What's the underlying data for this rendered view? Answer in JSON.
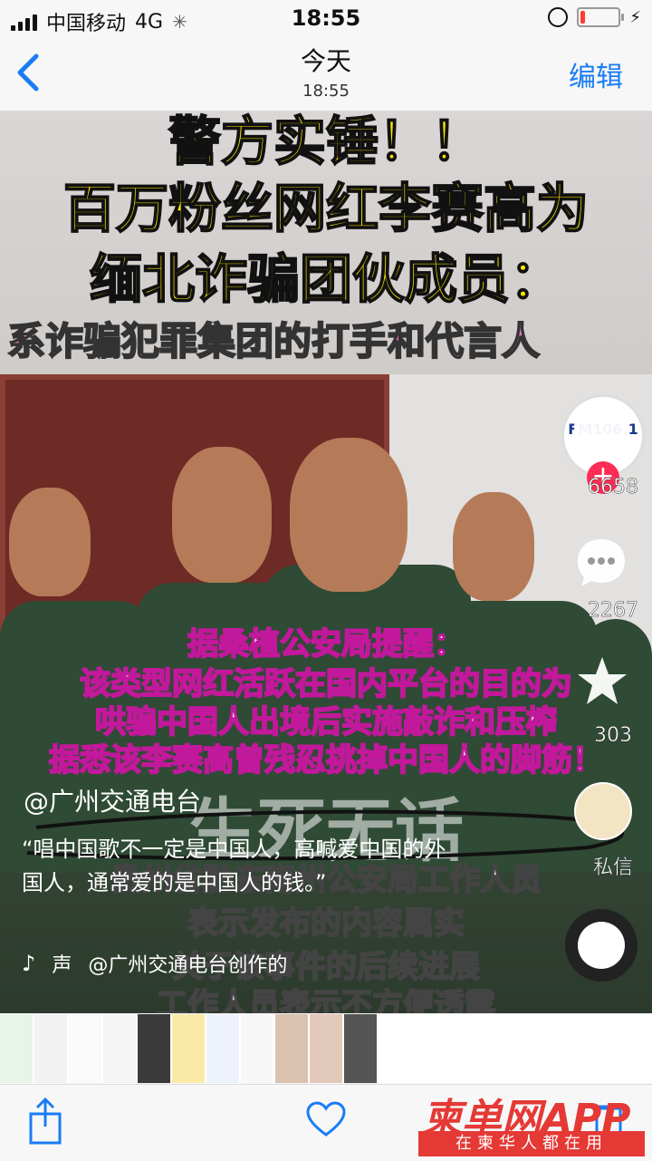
{
  "status": {
    "carrier": "中国移动",
    "network": "4G",
    "time": "18:55",
    "battery_level": 0.12
  },
  "nav": {
    "title": "今天",
    "subtitle": "18:55",
    "edit": "编辑"
  },
  "video": {
    "captions": {
      "line1": "警方实锤！！",
      "line2": "百万粉丝网红李赛高为",
      "line3": "缅北诈骗团伙成员：",
      "line4": "系诈骗犯罪集团的打手和代言人",
      "mid1": "据桑植公安局提醒：",
      "mid2": "该类型网红活跃在国内平台的目的为",
      "mid3": "哄骗中国人出境后实施敲诈和压榨",
      "mid4": "据悉该李赛高曾残忍挑掉中国人的脚筋！",
      "big": "生死无话",
      "low1": "贵州省黔东南州公安局工作人员",
      "low2": "表示发布的内容属实",
      "low3": "关于该事件的后续进展",
      "low4": "工作人员表示不方便透露"
    },
    "avatar_label": "FM106.1",
    "likes": "6658",
    "comments": "2267",
    "favorites": "303",
    "dm_label": "私信",
    "account": "@广州交通电台",
    "description": "“唱中国歌不一定是中国人，高喊爱中国的外国人，通常爱的是中国人的钱。”",
    "music_prefix": "声",
    "music_credit": "@广州交通电台创作的"
  },
  "watermark": {
    "brand": "柬单网APP",
    "slogan": "在柬华人都在用"
  },
  "colors": {
    "accent": "#1a7cf5",
    "plus": "#fe2c55",
    "watermark": "#e53935"
  }
}
